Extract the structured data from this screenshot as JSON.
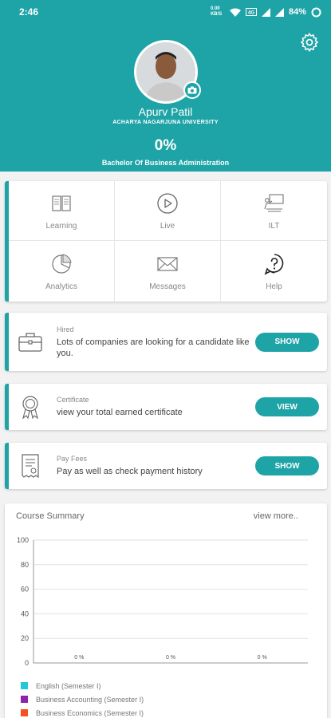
{
  "status": {
    "time": "2:46",
    "data_rate": "0.00 KB/S",
    "battery": "84%"
  },
  "profile": {
    "name": "Apurv Patil",
    "university": "ACHARYA NAGARJUNA UNIVERSITY",
    "progress_text": "0%",
    "degree": "Bachelor Of Business Administration"
  },
  "menu": [
    {
      "label": "Learning",
      "icon": "book-icon"
    },
    {
      "label": "Live",
      "icon": "play-icon"
    },
    {
      "label": "ILT",
      "icon": "presenter-icon"
    },
    {
      "label": "Analytics",
      "icon": "pie-chart-icon"
    },
    {
      "label": "Messages",
      "icon": "envelope-icon"
    },
    {
      "label": "Help",
      "icon": "question-icon"
    }
  ],
  "cards": {
    "hired": {
      "caption": "Hired",
      "description": "Lots of companies are looking for a candidate like you.",
      "button": "SHOW"
    },
    "certificate": {
      "caption": "Certificate",
      "description": "view your total earned certificate",
      "button": "VIEW"
    },
    "fees": {
      "caption": "Pay Fees",
      "description": "Pay as well as check payment history",
      "button": "SHOW"
    }
  },
  "summary": {
    "title": "Course Summary",
    "more": "view more.."
  },
  "colors": {
    "primary": "#1ea3a6"
  },
  "chart_data": {
    "type": "bar",
    "categories": [
      "English (Semester I)",
      "Business Accounting (Semester I)",
      "Business Economics (Semester I)"
    ],
    "series": [
      {
        "values": [
          0,
          0,
          0
        ]
      }
    ],
    "data_labels": [
      "0 %",
      "0 %",
      "0 %"
    ],
    "colors": [
      "#26c6da",
      "#8e24aa",
      "#f4511e"
    ],
    "ylim": [
      0,
      100
    ],
    "yticks": [
      0,
      20,
      40,
      60,
      80,
      100
    ],
    "grid": true,
    "legend_position": "bottom"
  }
}
